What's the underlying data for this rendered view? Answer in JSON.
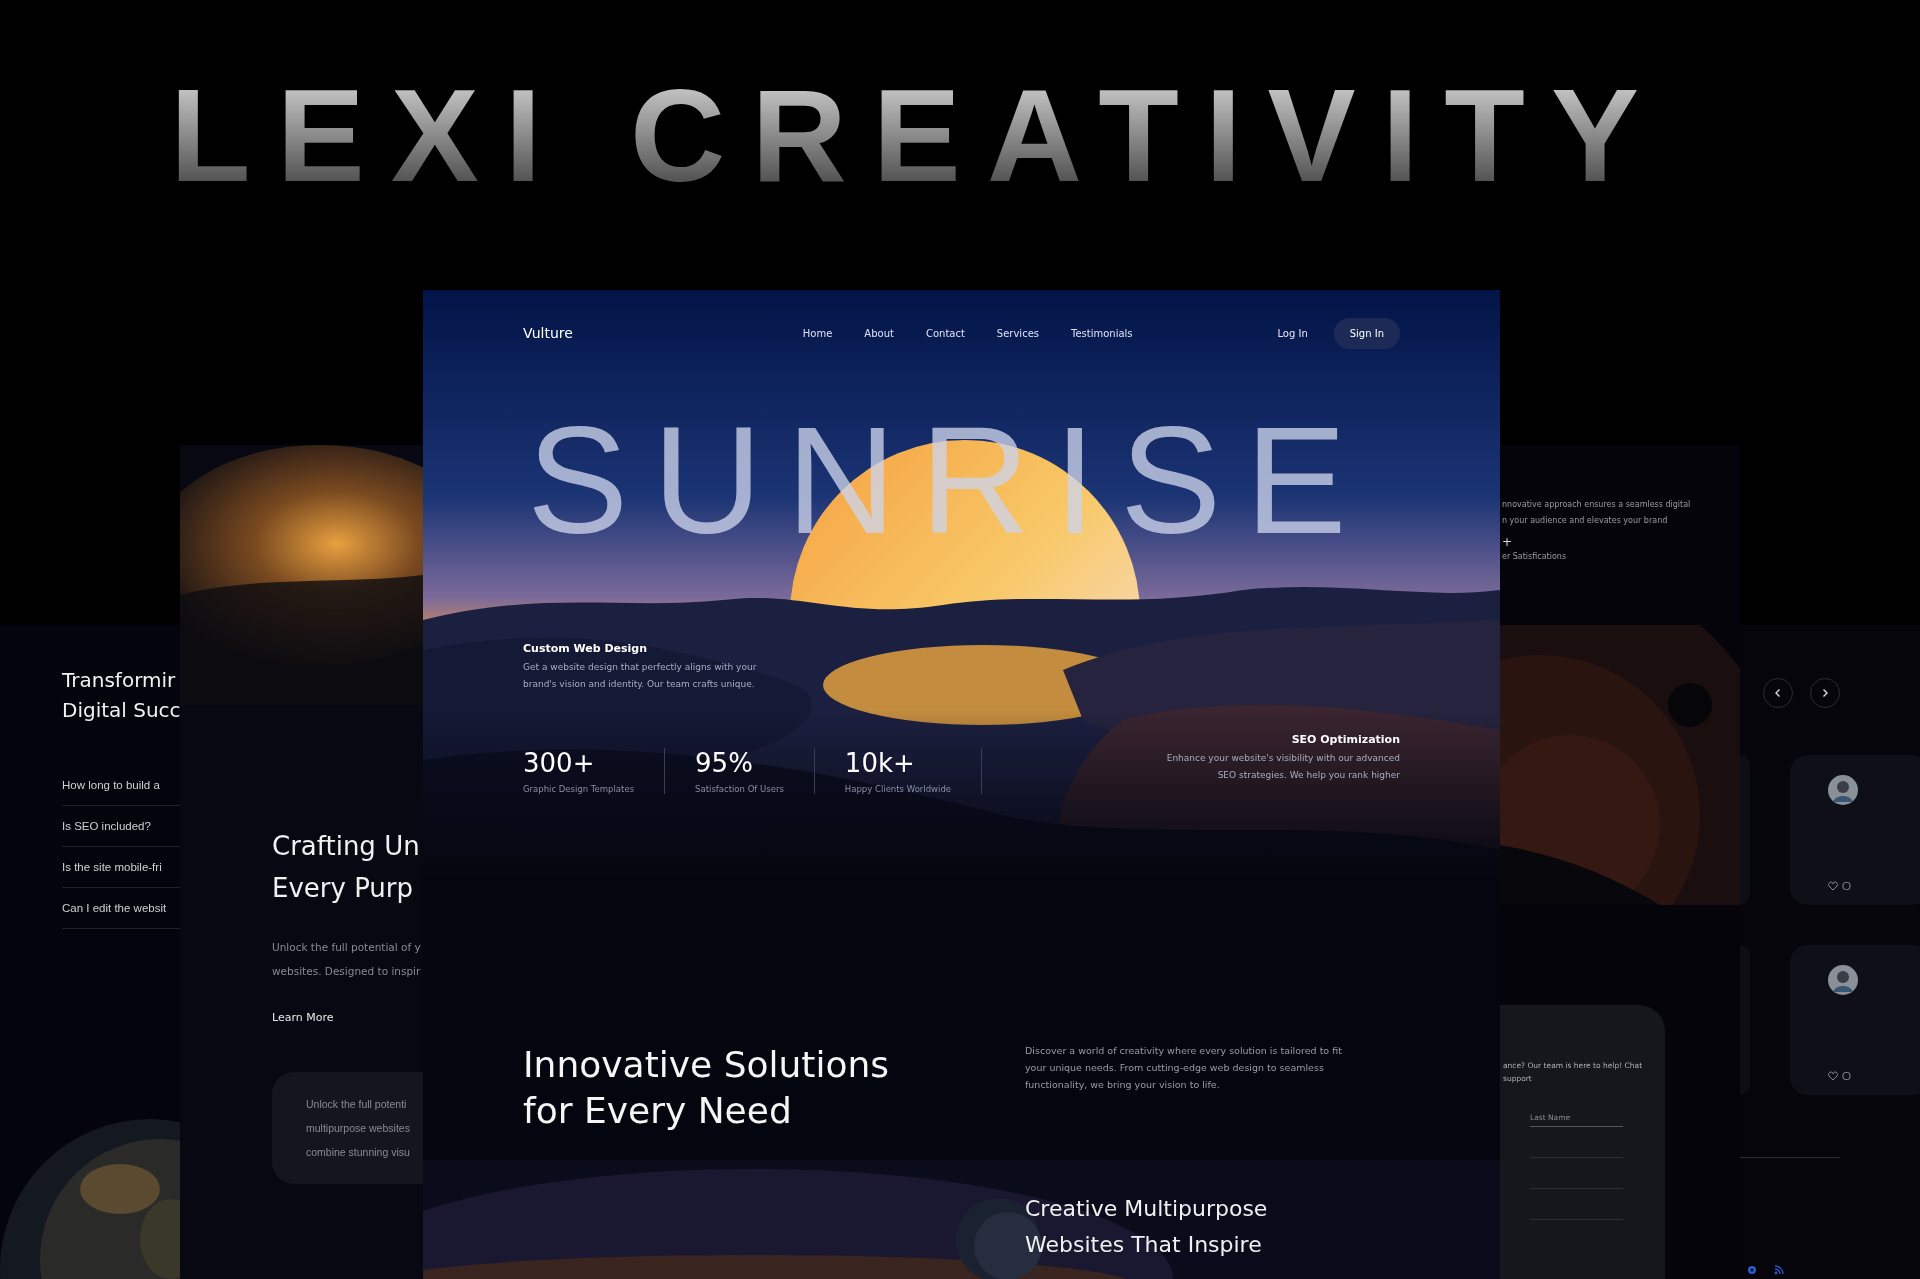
{
  "showcase_title": "LEXI CREATIVITY",
  "faq_panel": {
    "heading_lines": [
      "Transformir",
      "Digital Succ"
    ],
    "questions": [
      "How long to build a",
      "Is SEO included?",
      "Is the site mobile-fri",
      "Can I edit the websit"
    ]
  },
  "crafting_panel": {
    "heading_lines": [
      "Crafting Un",
      "Every Purp"
    ],
    "body_lines": [
      "Unlock the full potential of y",
      "websites. Designed to inspir"
    ],
    "link": "Learn More",
    "card_lines": [
      "Unlock the full potenti",
      "multipurpose websites",
      "combine stunning visu"
    ]
  },
  "main_page": {
    "nav": {
      "brand": "Vulture",
      "links": [
        "Home",
        "About",
        "Contact",
        "Services",
        "Testimonials"
      ],
      "login": "Log In",
      "signup": "Sign In"
    },
    "hero": {
      "title": "SUNRISE",
      "feature": {
        "title": "Custom Web Design",
        "text": "Get a website design that perfectly aligns with your brand's vision and identity. Our team crafts unique."
      },
      "stats": [
        {
          "value": "300+",
          "label": "Graphic Design Templates"
        },
        {
          "value": "95%",
          "label": "Satisfaction Of Users"
        },
        {
          "value": "10k+",
          "label": "Happy Clients Worldwide"
        }
      ],
      "seo": {
        "title": "SEO Optimization",
        "text": "Enhance your website's visibility with our advanced SEO strategies. We help you rank higher"
      }
    },
    "solutions": {
      "heading": "Innovative Solutions for Every Need",
      "text": "Discover a world of creativity where every solution is tailored to fit your unique needs. From cutting-edge web design to seamless functionality, we bring your vision to life.",
      "subheading": "Creative Multipurpose Websites That Inspire"
    }
  },
  "about_panel": {
    "text_lines": [
      "nnovative approach ensures a seamless digital",
      "n your audience and elevates your brand"
    ],
    "stat_value": "+",
    "stat_label": "er Satisfications"
  },
  "contact_panel": {
    "text_lines": [
      "ance? Our team is here to help! Chat",
      "support"
    ],
    "field_placeholder": "Last Name"
  }
}
